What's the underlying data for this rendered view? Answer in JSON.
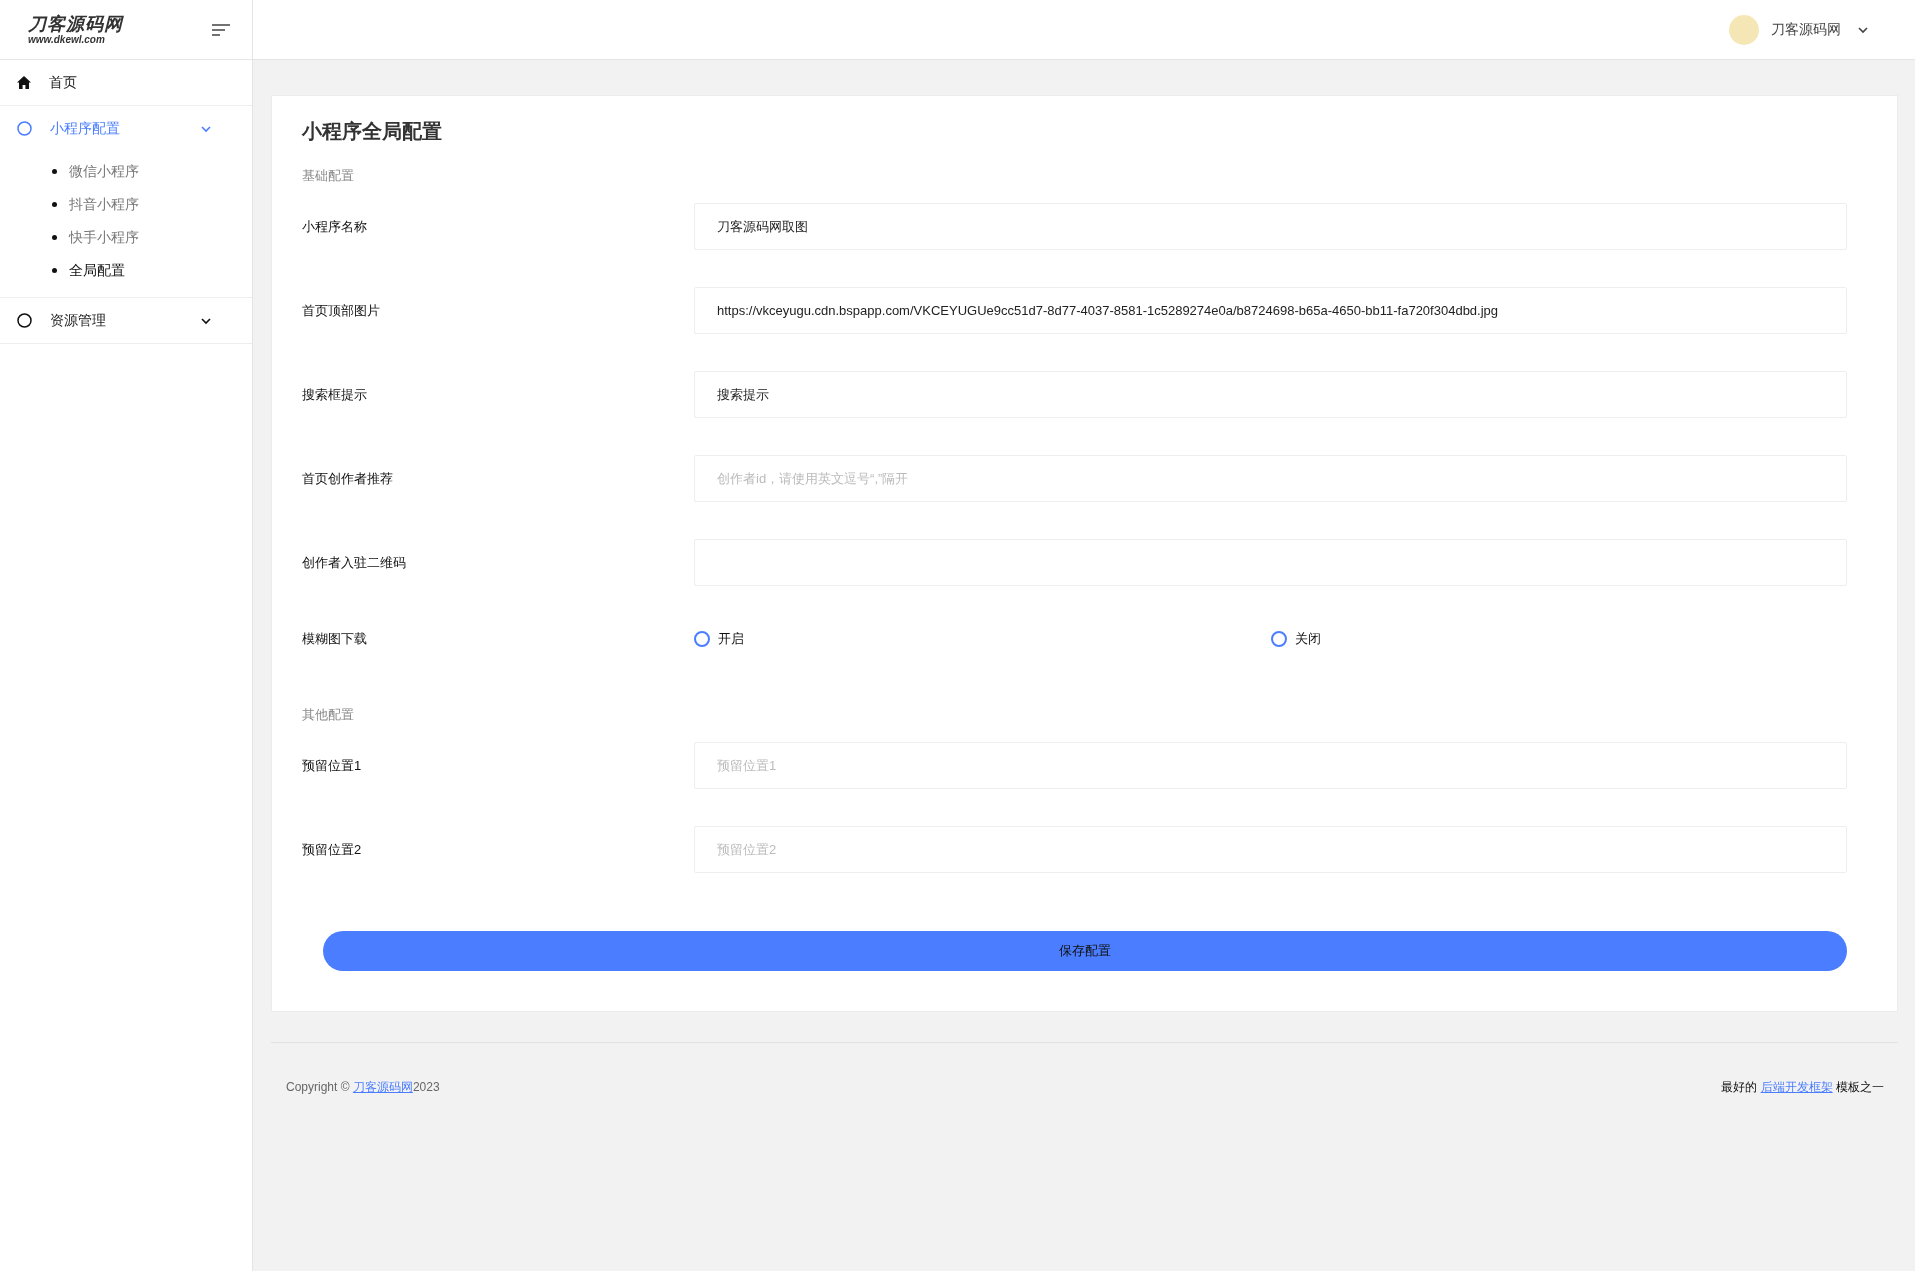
{
  "logo": {
    "title": "刀客源码网",
    "subtitle": "www.dkewl.com"
  },
  "sidebar": {
    "items": [
      {
        "kind": "link",
        "label": "首页",
        "selected": false
      },
      {
        "kind": "group",
        "label": "小程序配置",
        "selected": true,
        "expanded": true,
        "children": [
          {
            "label": "微信小程序",
            "selected": false
          },
          {
            "label": "抖音小程序",
            "selected": false
          },
          {
            "label": "快手小程序",
            "selected": false
          },
          {
            "label": "全局配置",
            "selected": true
          }
        ]
      },
      {
        "kind": "group",
        "label": "资源管理",
        "selected": false,
        "expanded": false
      }
    ]
  },
  "header": {
    "user": "刀客源码网"
  },
  "form": {
    "title": "小程序全局配置",
    "sections": [
      {
        "heading": "基础配置",
        "fields": [
          {
            "kind": "input",
            "label": "小程序名称",
            "value": "刀客源码网取图"
          },
          {
            "kind": "input",
            "label": "首页顶部图片",
            "value": "https://vkceyugu.cdn.bspapp.com/VKCEYUGUe9cc51d7-8d77-4037-8581-1c5289274e0a/b8724698-b65a-4650-bb11-fa720f304dbd.jpg"
          },
          {
            "kind": "input",
            "label": "搜索框提示",
            "value": "搜索提示"
          },
          {
            "kind": "input",
            "label": "首页创作者推荐",
            "placeholder": "创作者id，请使用英文逗号“,”隔开"
          },
          {
            "kind": "input",
            "label": "创作者入驻二维码"
          },
          {
            "kind": "radio",
            "label": "模糊图下载",
            "options": [
              {
                "label": "开启",
                "selected": false
              },
              {
                "label": "关闭",
                "selected": false
              }
            ]
          }
        ]
      },
      {
        "heading": "其他配置",
        "fields": [
          {
            "kind": "input",
            "label": "预留位置1",
            "placeholder": "预留位置1"
          },
          {
            "kind": "input",
            "label": "预留位置2",
            "placeholder": "预留位置2"
          }
        ]
      }
    ],
    "submit": "保存配置"
  },
  "footer": {
    "copyright_prefix": "Copyright ©",
    "copyright_link": "刀客源码网",
    "copyright_year": "2023",
    "right_prefix": "最好的",
    "right_link": "后端开发框架",
    "right_suffix": "模板之一"
  }
}
